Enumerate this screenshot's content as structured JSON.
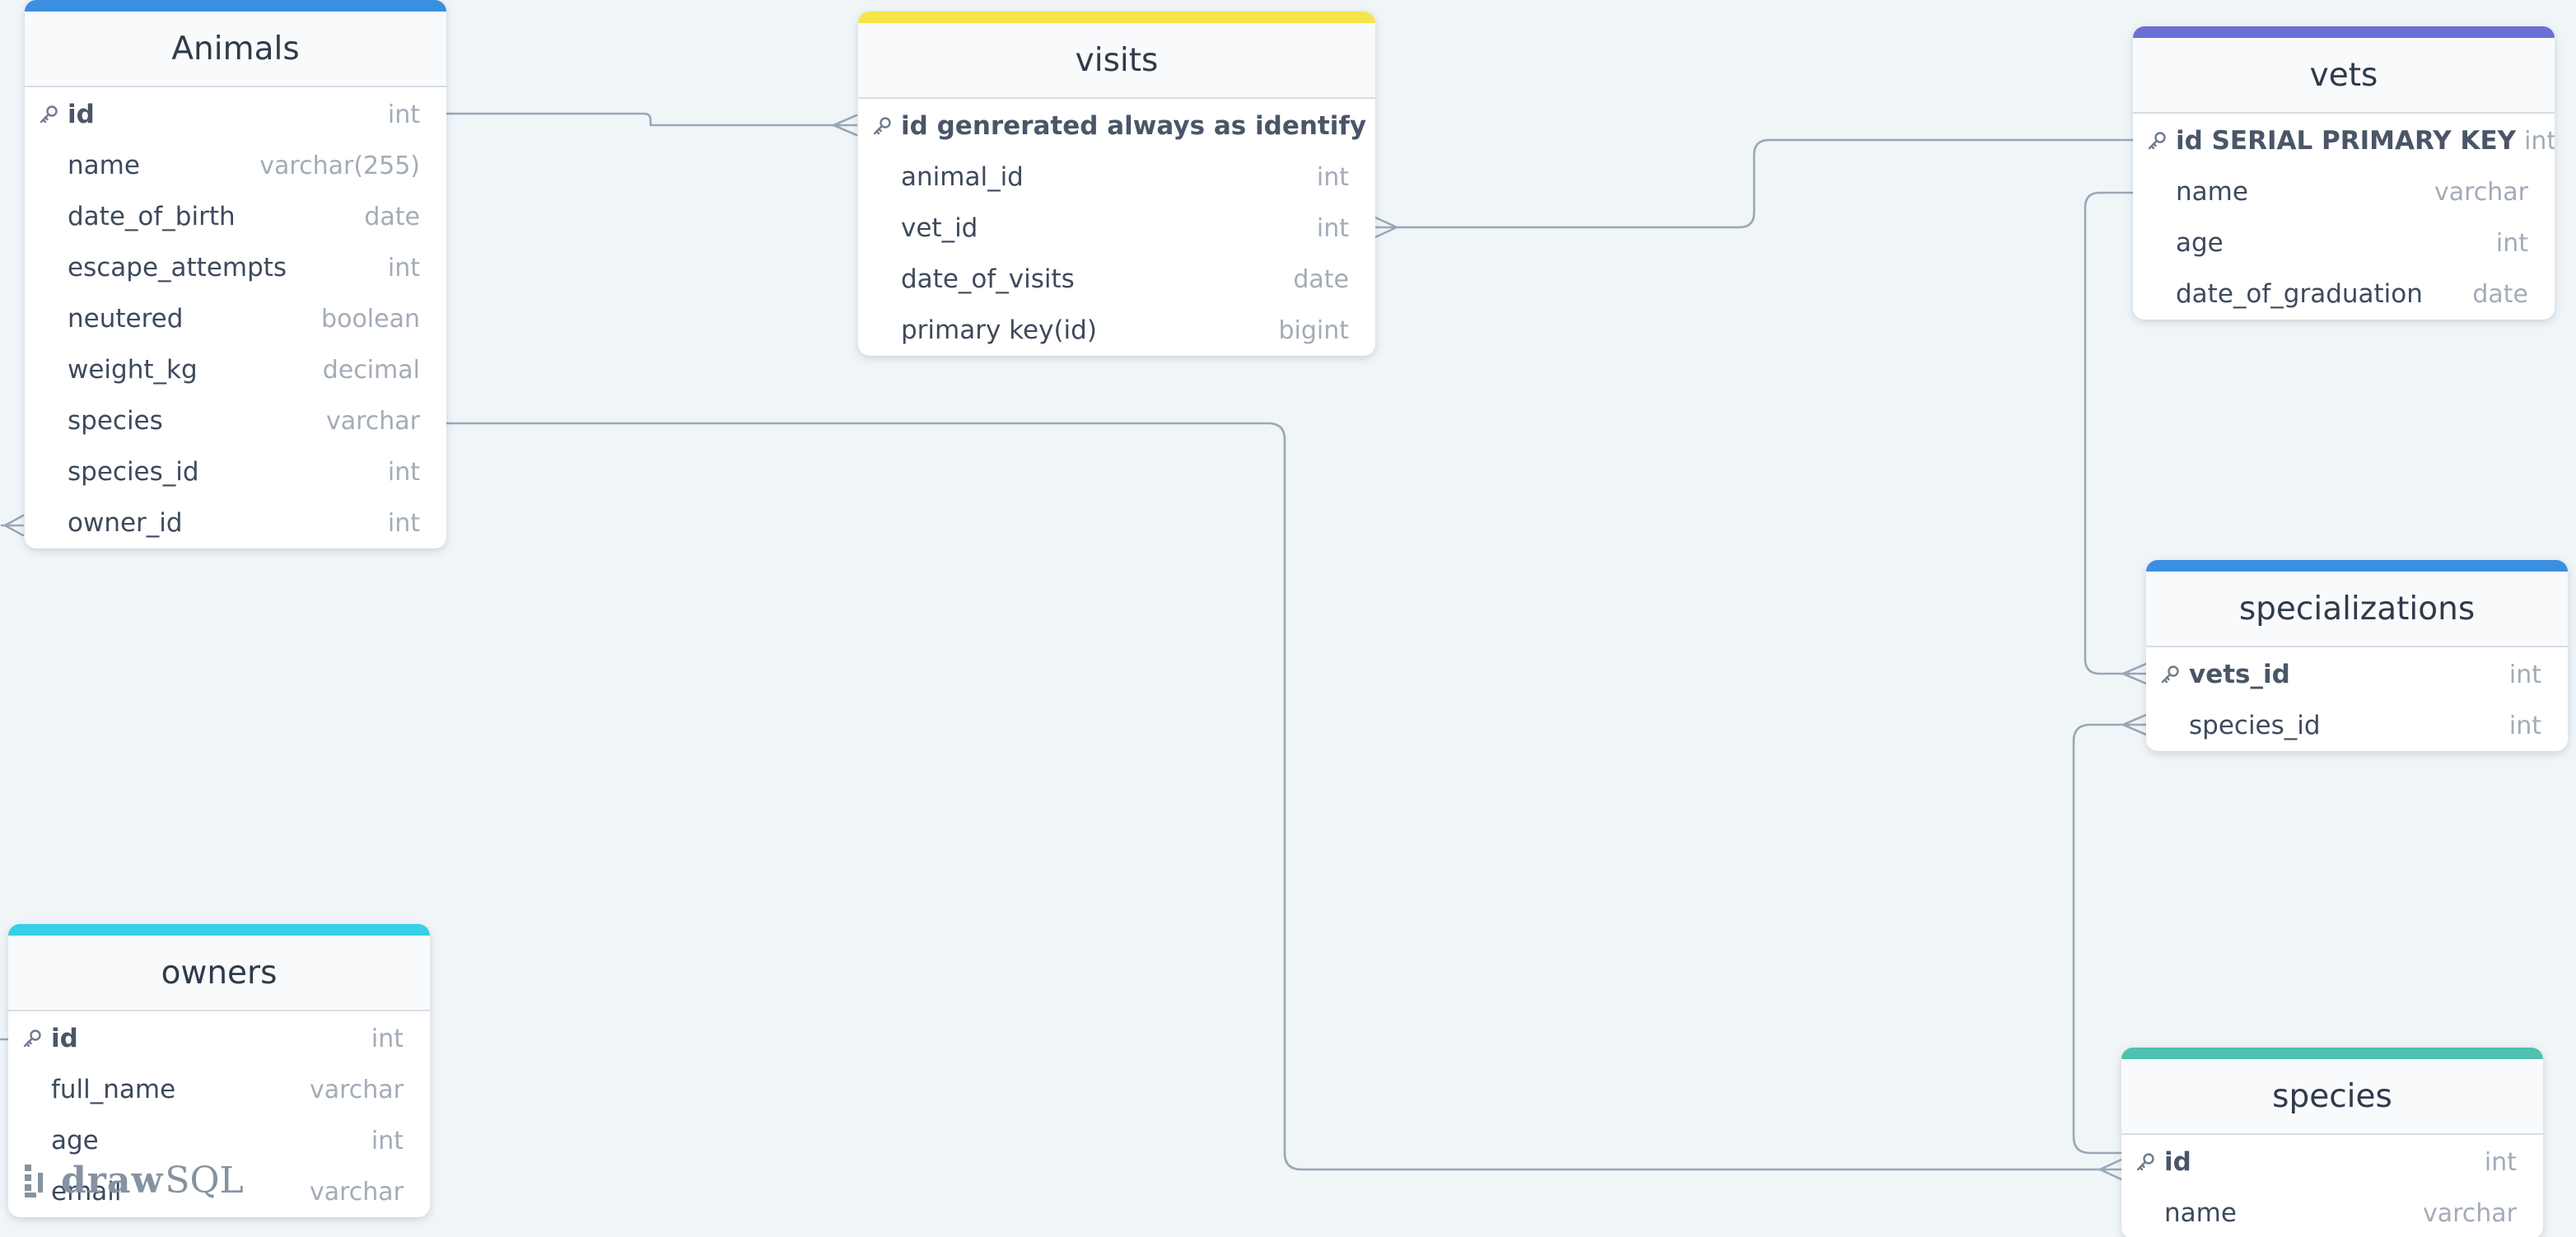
{
  "tables": [
    {
      "id": "animals",
      "title": "Animals",
      "accent": "#3a8fe0",
      "columns": [
        {
          "name": "id",
          "type": "int",
          "pk": true
        },
        {
          "name": "name",
          "type": "varchar(255)"
        },
        {
          "name": "date_of_birth",
          "type": "date"
        },
        {
          "name": "escape_attempts",
          "type": "int"
        },
        {
          "name": "neutered",
          "type": "boolean"
        },
        {
          "name": "weight_kg",
          "type": "decimal"
        },
        {
          "name": "species",
          "type": "varchar"
        },
        {
          "name": "species_id",
          "type": "int"
        },
        {
          "name": "owner_id",
          "type": "int"
        }
      ]
    },
    {
      "id": "visits",
      "title": "visits",
      "accent": "#f7e34a",
      "columns": [
        {
          "name": "id genrerated always as identify",
          "type": "int",
          "pk": true
        },
        {
          "name": "animal_id",
          "type": "int"
        },
        {
          "name": "vet_id",
          "type": "int"
        },
        {
          "name": "date_of_visits",
          "type": "date"
        },
        {
          "name": "primary key(id)",
          "type": "bigint"
        }
      ]
    },
    {
      "id": "vets",
      "title": "vets",
      "accent": "#6a6fd3",
      "columns": [
        {
          "name": "id SERIAL PRIMARY KEY",
          "type": "int",
          "pk": true
        },
        {
          "name": "name",
          "type": "varchar"
        },
        {
          "name": "age",
          "type": "int"
        },
        {
          "name": "date_of_graduation",
          "type": "date"
        }
      ]
    },
    {
      "id": "specializations",
      "title": "specializations",
      "accent": "#3a8fe0",
      "columns": [
        {
          "name": "vets_id",
          "type": "int",
          "pk": true
        },
        {
          "name": "species_id",
          "type": "int"
        }
      ]
    },
    {
      "id": "owners",
      "title": "owners",
      "accent": "#35cfe6",
      "columns": [
        {
          "name": "id",
          "type": "int",
          "pk": true
        },
        {
          "name": "full_name",
          "type": "varchar"
        },
        {
          "name": "age",
          "type": "int"
        },
        {
          "name": "email",
          "type": "varchar"
        }
      ]
    },
    {
      "id": "species",
      "title": "species",
      "accent": "#4fc1b0",
      "columns": [
        {
          "name": "id",
          "type": "int",
          "pk": true
        },
        {
          "name": "name",
          "type": "varchar"
        }
      ]
    }
  ],
  "relations": [
    {
      "from": "animals.id",
      "to": "visits.animal_id",
      "cardinality": "one-to-many"
    },
    {
      "from": "vets.id",
      "to": "visits.vet_id",
      "cardinality": "one-to-many"
    },
    {
      "from": "vets.id",
      "to": "specializations.vets_id",
      "cardinality": "one-to-many"
    },
    {
      "from": "species.id",
      "to": "specializations.species_id",
      "cardinality": "one-to-many"
    },
    {
      "from": "species.id",
      "to": "animals.species",
      "cardinality": "one-to-many"
    },
    {
      "from": "owners.id",
      "to": "animals.owner_id",
      "cardinality": "one-to-many"
    }
  ],
  "colors": {
    "canvas": "#f0f5f8",
    "connector": "#9aa7b6"
  },
  "watermark": {
    "brand_bold": "draw",
    "brand_light": "SQL"
  }
}
